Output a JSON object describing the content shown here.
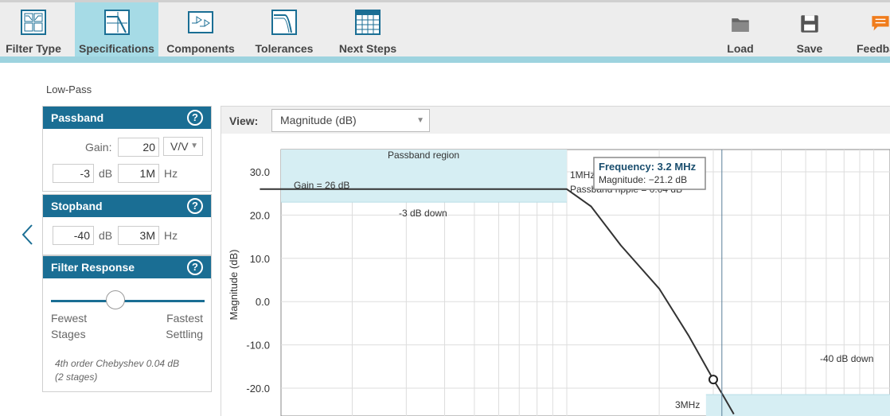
{
  "toolbar": {
    "items": [
      {
        "label": "Filter Type",
        "icon": "filter-type-icon"
      },
      {
        "label": "Specifications",
        "icon": "specifications-icon",
        "active": true
      },
      {
        "label": "Components",
        "icon": "components-icon"
      },
      {
        "label": "Tolerances",
        "icon": "tolerances-icon"
      },
      {
        "label": "Next Steps",
        "icon": "next-steps-icon"
      }
    ],
    "right_items": [
      {
        "label": "Load",
        "icon": "folder-icon"
      },
      {
        "label": "Save",
        "icon": "floppy-icon"
      },
      {
        "label": "Feedba",
        "icon": "feedback-icon"
      }
    ]
  },
  "filter_type_label": "Low-Pass",
  "passband": {
    "title": "Passband",
    "gain_label": "Gain:",
    "gain_value": "20",
    "gain_unit": "V/V",
    "attenuation_value": "-3",
    "attenuation_unit": "dB",
    "freq_value": "1M",
    "freq_unit": "Hz"
  },
  "stopband": {
    "title": "Stopband",
    "attenuation_value": "-40",
    "attenuation_unit": "dB",
    "freq_value": "3M",
    "freq_unit": "Hz"
  },
  "filter_response": {
    "title": "Filter Response",
    "left_label_1": "Fewest",
    "left_label_2": "Stages",
    "right_label_1": "Fastest",
    "right_label_2": "Settling",
    "slider_value": 0.4,
    "note_line_1": "4th order Chebyshev 0.04 dB",
    "note_line_2": "(2 stages)"
  },
  "help_glyph": "?",
  "view": {
    "label": "View:",
    "selected": "Magnitude (dB)"
  },
  "chart_data": {
    "type": "line",
    "ylabel": "Magnitude (dB)",
    "y_ticks": [
      "30.0",
      "20.0",
      "10.0",
      "0.0",
      "-10.0",
      "-20.0"
    ],
    "y_tick_values": [
      30,
      20,
      10,
      0,
      -10,
      -20
    ],
    "x_scale": "log",
    "grid": true,
    "annotations": {
      "passband_region": "Passband region",
      "gain": "Gain = 26 dB",
      "minus3_down": "-3 dB down",
      "one_mhz": "1MHz",
      "passband_ripple": "Passband ripple = 0.04 dB",
      "minus40_down": "-40 dB down",
      "three_mhz": "3MHz"
    },
    "tooltip": {
      "title": "Frequency: 3.2 MHz",
      "line": "Magnitude: −21.2 dB"
    },
    "series": [
      {
        "x_mhz": [
          0.1,
          0.5,
          0.9,
          1.0,
          1.2,
          1.5,
          2.0,
          2.5,
          3.0,
          3.2,
          3.5
        ],
        "y_db": [
          26,
          26,
          26,
          26,
          22,
          13,
          3,
          -8,
          -18,
          -21.2,
          -26
        ]
      }
    ],
    "marker": {
      "x_mhz": 3.0,
      "y_db": -18
    },
    "colors": {
      "region": "#d6eef3",
      "line": "#333333",
      "grid": "#dddddd"
    }
  }
}
